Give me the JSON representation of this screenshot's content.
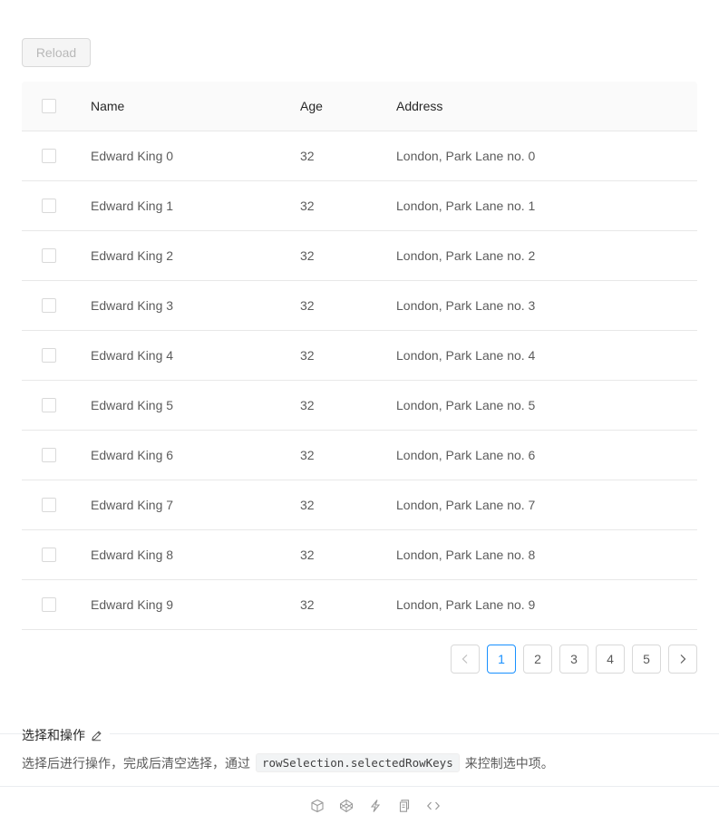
{
  "toolbar": {
    "reload_label": "Reload"
  },
  "table": {
    "columns": {
      "name": "Name",
      "age": "Age",
      "address": "Address"
    },
    "rows": [
      {
        "name": "Edward King 0",
        "age": "32",
        "address": "London, Park Lane no. 0"
      },
      {
        "name": "Edward King 1",
        "age": "32",
        "address": "London, Park Lane no. 1"
      },
      {
        "name": "Edward King 2",
        "age": "32",
        "address": "London, Park Lane no. 2"
      },
      {
        "name": "Edward King 3",
        "age": "32",
        "address": "London, Park Lane no. 3"
      },
      {
        "name": "Edward King 4",
        "age": "32",
        "address": "London, Park Lane no. 4"
      },
      {
        "name": "Edward King 5",
        "age": "32",
        "address": "London, Park Lane no. 5"
      },
      {
        "name": "Edward King 6",
        "age": "32",
        "address": "London, Park Lane no. 6"
      },
      {
        "name": "Edward King 7",
        "age": "32",
        "address": "London, Park Lane no. 7"
      },
      {
        "name": "Edward King 8",
        "age": "32",
        "address": "London, Park Lane no. 8"
      },
      {
        "name": "Edward King 9",
        "age": "32",
        "address": "London, Park Lane no. 9"
      }
    ]
  },
  "pagination": {
    "pages": [
      "1",
      "2",
      "3",
      "4",
      "5"
    ],
    "current": "1",
    "prev_icon": "chevron-left-icon",
    "next_icon": "chevron-right-icon"
  },
  "demo": {
    "title": "选择和操作",
    "edit_icon": "edit-icon",
    "desc_before": "选择后进行操作，完成后清空选择，通过",
    "desc_code": "rowSelection.selectedRowKeys",
    "desc_after": "来控制选中项。",
    "actions": [
      "codesandbox-icon",
      "codepen-icon",
      "riddle-icon",
      "copy-icon",
      "code-icon"
    ]
  },
  "colors": {
    "primary": "#1890ff",
    "border": "#e8e8e8",
    "header_bg": "#fafafa"
  }
}
